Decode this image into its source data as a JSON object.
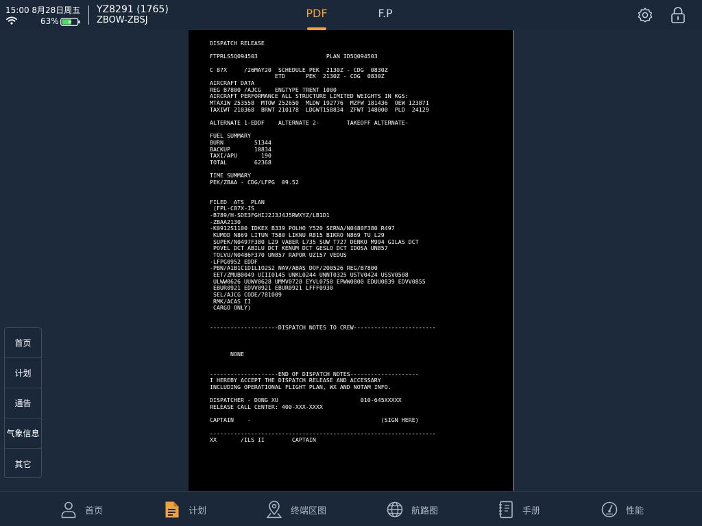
{
  "status_bar": {
    "time_date": "15:00 8月28日周五",
    "battery_percent": "63%",
    "battery_level": 0.63
  },
  "flight": {
    "number": "YZ8291 (1765)",
    "route": "ZBOW-ZBSJ"
  },
  "top_tabs": [
    {
      "label": "PDF",
      "active": true
    },
    {
      "label": "F.P",
      "active": false
    }
  ],
  "document": {
    "lines": [
      "DISPATCH RELEASE",
      "",
      "FTPRLS5Q094503                    PLAN ID5Q094503",
      "",
      "C 87X     /26MAY20  SCHEDULE PEK  2130Z - CDG  0830Z",
      "                   ETD      PEK  2130Z - CDG  0830Z",
      "AIRCRAFT DATA",
      "REG B7800 /AJCG    ENGTYPE TRENT 1000",
      "AIRCRAFT PERFORMANCE ALL STRUCTURE LIMITED WEIGHTS IN KGS:",
      "MTAXIW 253558  MTOW 252650  MLDW 192776  MZFW 181436  OEW 123871",
      "TAXIWT 210368  BRWT 210178  LDGWT158834  ZFWT 148000  PLD  24129",
      "",
      "ALTERNATE 1-EDDF    ALTERNATE 2-        TAKEOFF ALTERNATE-",
      "",
      "FUEL SUMMARY",
      "BURN         51344",
      "BACKUP       10834",
      "TAXI/APU       190",
      "TOTAL        62368",
      "",
      "TIME SUMMARY",
      "PEK/ZBAA - CDG/LFPG  09.52",
      "",
      "",
      "FILED  ATS  PLAN",
      " (FPL-C87X-IS",
      "-B789/H-SDE3FGHIJ2J3J4J5RWXYZ/LB1D1",
      "-ZBAA2130",
      "-K0912S1100 IDKEX B339 POLHO Y520 SERNA/N0480F380 R497",
      " KUMOD N869 LITUN T580 LIKNU R815 BIKRO N869 TU L29",
      " SUPEK/N0497F380 L29 VABER L735 SUW T727 DENKO M994 GILAS DCT",
      " POVEL DCT ABILU DCT KENUM DCT GESLO DCT IDOSA UN857",
      " TOLVU/N0486F370 UN857 RAPOR UZ157 VEDUS",
      "-LFPG0952 EDDF",
      "-PBN/A1B1C1D1L1O2S2 NAV/ABAS DOF/200526 REG/B7800",
      " EET/ZMUB0049 UIII0145 UNKL0244 UNNT0325 USTV0424 USSV0508",
      " ULWW0626 UUWV0628 UMMV0728 EYVL0750 EPWW0800 EDUU0839 EDVV0855",
      " EBUR0921 EDVV0921 EBUR0921 LFFF0930",
      " SEL/AJCG CODE/781009",
      " RMK/ACAS II",
      " CARGO ONLY)",
      "",
      "",
      "--------------------DISPATCH NOTES TO CREW------------------------",
      "",
      "",
      "",
      "      NONE",
      "",
      "",
      "--------------------END OF DISPATCH NOTES--------------------",
      "I HEREBY ACCEPT THE DISPATCH RELEASE AND ACCESSARY",
      "INCLUDING OPERATIONAL FLIGHT PLAN, WX AND NOTAM INFO.",
      "",
      "DISPATCHER - DONG XU                        010-645XXXXX",
      "RELEASE CALL CENTER: 400-XXX-XXXX",
      "",
      "CAPTAIN    -                                      (SIGN HERE)",
      "",
      "------------------------------------------------------------------",
      "XX       /ILS II        CAPTAIN"
    ]
  },
  "side_menu": [
    {
      "label": "首页",
      "active": true
    },
    {
      "label": "计划",
      "active": false
    },
    {
      "label": "通告",
      "active": false
    },
    {
      "label": "气象信息",
      "active": false
    },
    {
      "label": "其它",
      "active": false
    }
  ],
  "bottom_nav": [
    {
      "label": "首页",
      "icon": "person-icon",
      "active": false
    },
    {
      "label": "计划",
      "icon": "document-icon",
      "active": true
    },
    {
      "label": "终端区图",
      "icon": "map-pin-icon",
      "active": false
    },
    {
      "label": "航路图",
      "icon": "globe-icon",
      "active": false
    },
    {
      "label": "手册",
      "icon": "manual-icon",
      "active": false
    },
    {
      "label": "性能",
      "icon": "gauge-icon",
      "active": false
    }
  ],
  "colors": {
    "accent": "#f0a33a",
    "active_blue": "#1f6bd2",
    "background": "#1d2a3b",
    "battery_green": "#4cd964"
  }
}
